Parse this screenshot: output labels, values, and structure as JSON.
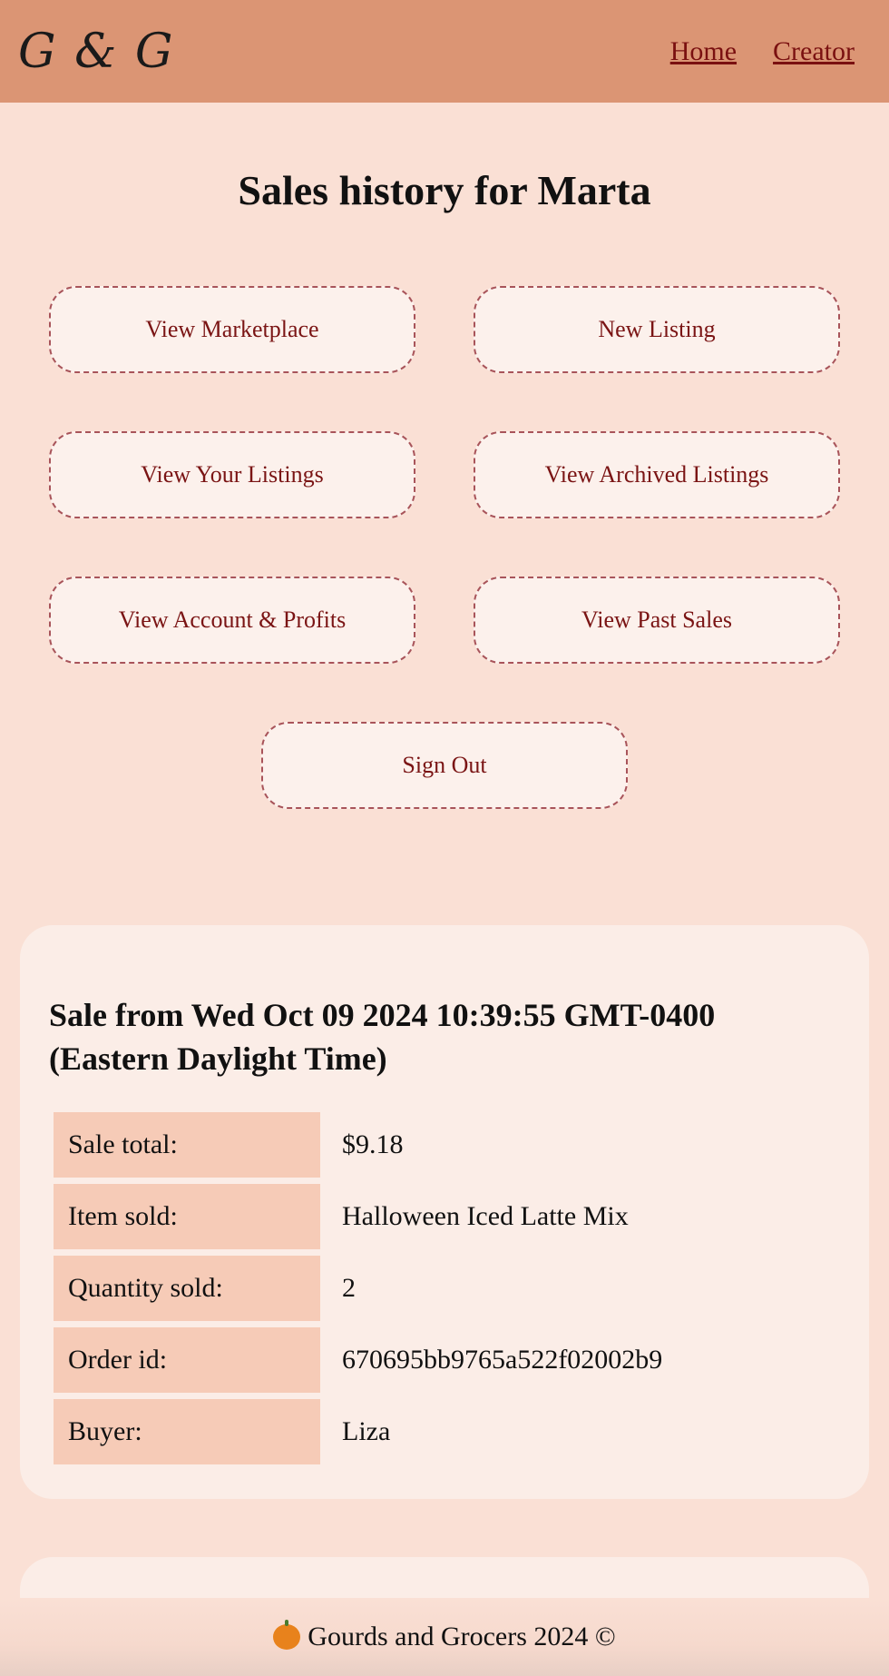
{
  "nav": {
    "logo": "G & G",
    "links": [
      "Home",
      "Creator"
    ]
  },
  "page_title": "Sales history for Marta",
  "buttons": {
    "view_marketplace": "View Marketplace",
    "new_listing": "New Listing",
    "view_your_listings": "View Your Listings",
    "view_archived_listings": "View Archived Listings",
    "view_account_profits": "View Account & Profits",
    "view_past_sales": "View Past Sales",
    "sign_out": "Sign Out"
  },
  "sales": [
    {
      "title": "Sale from Wed Oct 09 2024 10:39:55 GMT-0400 (Eastern Daylight Time)",
      "rows": [
        {
          "label": "Sale total:",
          "value": "$9.18"
        },
        {
          "label": "Item sold:",
          "value": "Halloween Iced Latte Mix"
        },
        {
          "label": "Quantity sold:",
          "value": "2"
        },
        {
          "label": "Order id:",
          "value": "670695bb9765a522f02002b9"
        },
        {
          "label": "Buyer:",
          "value": "Liza"
        }
      ]
    }
  ],
  "footer": {
    "icon": "pumpkin-icon",
    "text": "Gourds and Grocers 2024 ©"
  },
  "colors": {
    "navbar": "#db9574",
    "background": "#fae0d5",
    "button_bg": "#fcf1ec",
    "button_text": "#7a1414",
    "label_bg": "#f6cbb7",
    "card_bg": "#fbede7"
  }
}
